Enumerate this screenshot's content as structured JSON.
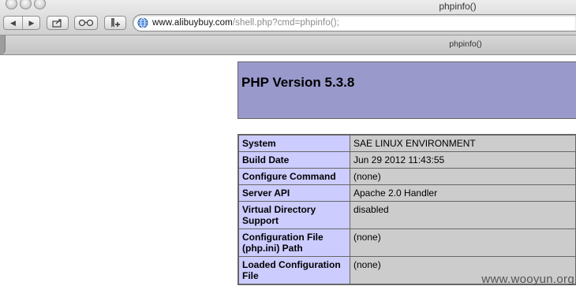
{
  "window": {
    "title": "phpinfo()"
  },
  "address_bar": {
    "host": "www.alibuybuy.com",
    "path": "/shell.php?cmd=phpinfo();"
  },
  "tab": {
    "label": "phpinfo()"
  },
  "page": {
    "heading": "PHP Version 5.3.8",
    "rows": [
      {
        "key": "System",
        "value": "SAE LINUX ENVIRONMENT"
      },
      {
        "key": "Build Date",
        "value": "Jun 29 2012 11:43:55"
      },
      {
        "key": "Configure Command",
        "value": "(none)"
      },
      {
        "key": "Server API",
        "value": "Apache 2.0 Handler"
      },
      {
        "key": "Virtual Directory Support",
        "value": "disabled"
      },
      {
        "key": "Configuration File (php.ini) Path",
        "value": "(none)"
      },
      {
        "key": "Loaded Configuration File",
        "value": "(none)"
      }
    ]
  },
  "watermark": "www.wooyun.org",
  "icons": [
    "back-icon",
    "forward-icon",
    "share-icon",
    "reading-list-icon",
    "add-bookmark-icon",
    "globe-icon"
  ],
  "colors": {
    "header_bg": "#9999cc",
    "key_cell_bg": "#ccccff",
    "value_cell_bg": "#cccccc"
  }
}
